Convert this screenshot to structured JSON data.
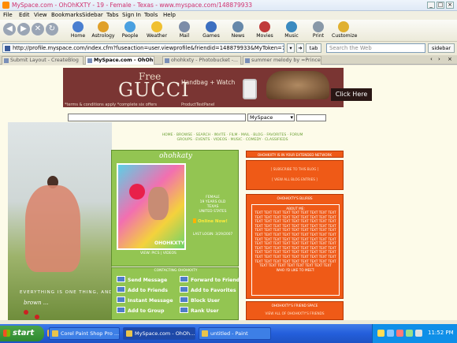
{
  "window": {
    "title": "MySpace.com - OhOhKXTY - 19 - Female - Texas - www.myspace.com/148879933"
  },
  "menu": [
    "File",
    "Edit",
    "View",
    "Bookmarks",
    "Sidebar",
    "Tabs",
    "Sign In",
    "Tools",
    "Help"
  ],
  "toolbar": {
    "buttons": [
      {
        "label": "Home",
        "icon": "home-icon",
        "color": "#4a7fd0"
      },
      {
        "label": "Astrology",
        "icon": "astrology-icon",
        "color": "#e0a02a"
      },
      {
        "label": "People",
        "icon": "people-icon",
        "color": "#4aa0e0"
      },
      {
        "label": "Weather",
        "icon": "weather-icon",
        "color": "#f0c030"
      },
      {
        "label": "Mail",
        "icon": "mail-icon",
        "color": "#7c8ca8"
      },
      {
        "label": "Games",
        "icon": "games-icon",
        "color": "#3c6fc0"
      },
      {
        "label": "News",
        "icon": "news-icon",
        "color": "#6688aa"
      },
      {
        "label": "Movies",
        "icon": "movies-icon",
        "color": "#c03a3a"
      },
      {
        "label": "Music",
        "icon": "music-icon",
        "color": "#3a8ac0"
      },
      {
        "label": "Print",
        "icon": "print-icon",
        "color": "#8898a8"
      },
      {
        "label": "Customize",
        "icon": "customize-icon",
        "color": "#e0b030"
      }
    ]
  },
  "urlbar": {
    "url": "http://profile.myspace.com/index.cfm?fuseaction=user.viewprofile&friendid=148879933&MyToken=7d3",
    "tab_button": "tab",
    "search_placeholder": "Search the Web",
    "sidebar_button": "sidebar"
  },
  "tabs": [
    {
      "label": "Submit Layout - CreateBlog",
      "active": false
    },
    {
      "label": "MySpace.com - OhOhKX...",
      "active": true
    },
    {
      "label": "ohohkxty - Photobucket -...",
      "active": false
    },
    {
      "label": "summer melody by =Prince...",
      "active": false
    }
  ],
  "ad": {
    "free": "Free",
    "brand": "GUCCI",
    "product": "Handbag + Watch",
    "cta": "Click Here",
    "fine_print": "*terms & conditions apply  *complete six offers",
    "sponsor": "ProductTestPanel"
  },
  "search": {
    "select_value": "MySpace"
  },
  "profile_bg": {
    "motto": "EVERYTHING IS ONE THING, AND",
    "signature": "brown ..."
  },
  "profile_nav": {
    "line1": "HOME · BROWSE · SEARCH · INVITE · FILM · MAIL · BLOG · FAVORITES · FORUM",
    "line2": "GROUPS · EVENTS · VIDEOS · MUSIC · COMEDY · CLASSIFIEDS"
  },
  "profile": {
    "name": "ohohkaty",
    "info": [
      "FEMALE",
      "19 YEARS OLD",
      "TEXAS",
      "UNITED STATES"
    ],
    "online": "Online Now!",
    "last_login": "LAST LOGIN: 3/29/2007",
    "view": "VIEW: PICS | VIDEOS",
    "pic_tag": "OHOHKXTY"
  },
  "contact": {
    "header": "CONTACTING OHOHKXTY",
    "items": [
      {
        "label": "Send Message"
      },
      {
        "label": "Forward to Friend"
      },
      {
        "label": "Add to Friends"
      },
      {
        "label": "Add to Favorites"
      },
      {
        "label": "Instant Message"
      },
      {
        "label": "Block User"
      },
      {
        "label": "Add to Group"
      },
      {
        "label": "Rank User"
      }
    ]
  },
  "right": {
    "network_header": "OHOHKXTY IS IN YOUR EXTENDED NETWORK",
    "blog_header": "[ SUBSCRIBE TO THIS BLOG ]",
    "blog_link": "[ VIEW ALL BLOG ENTRIES ]",
    "blurbs_header": "OHOHKXTY'S BLURBS",
    "about_me": "ABOUT ME:",
    "blurbs_text": "TEXT TEXT TEXT TEXT TEXT TEXT TEXT TEXT TEXT TEXT TEXT TEXT TEXT TEXT TEXT TEXT TEXT TEXT TEXT TEXT TEXT TEXT TEXT TEXT TEXT TEXT TEXT TEXT TEXT TEXT TEXT TEXT TEXT TEXT TEXT TEXT TEXT TEXT TEXT TEXT TEXT TEXT TEXT TEXT TEXT TEXT TEXT TEXT TEXT TEXT TEXT TEXT TEXT TEXT TEXT TEXT TEXT TEXT TEXT TEXT TEXT TEXT TEXT TEXT TEXT TEXT TEXT TEXT TEXT TEXT TEXT TEXT TEXT TEXT TEXT TEXT TEXT TEXT TEXT TEXT TEXT TEXT TEXT TEXT TEXT TEXT TEXT TEXT TEXT TEXT TEXT TEXT TEXT TEXT TEXT TEXT TEXT TEXT TEXT TEXT TEXT TEXT TEXT TEXT TEXT TEXT TEXT TEXT TEXT TEXT TEXT TEXT TEXT TEXT TEXT TEXT",
    "who_to_meet": "WHO I'D LIKE TO MEET:",
    "friend_space_header": "OHOHKXTY'S FRIEND SPACE",
    "friend_space_link": "VIEW ALL OF OHOHKXTY'S FRIENDS"
  },
  "taskbar": {
    "start": "start",
    "tasks": [
      {
        "label": "Corel Paint Shop Pro ...",
        "active": false
      },
      {
        "label": "MySpace.com - OhOh...",
        "active": true
      },
      {
        "label": "untitled - Paint",
        "active": false
      }
    ],
    "clock": "11:52 PM"
  }
}
